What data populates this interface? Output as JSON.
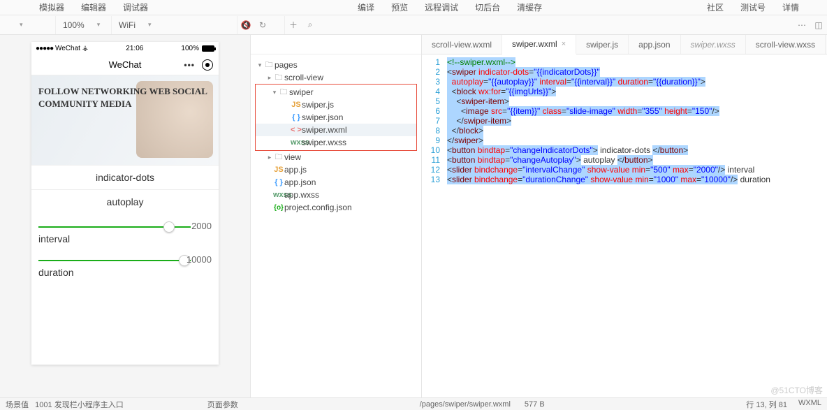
{
  "topbar": {
    "left": [
      "模拟器",
      "编辑器",
      "调试器"
    ],
    "mid": [
      "编译",
      "预览",
      "远程调试",
      "切后台",
      "清缓存"
    ],
    "right": [
      "社区",
      "测试号",
      "详情"
    ]
  },
  "subbar": {
    "dd1": "",
    "dd2": "100%",
    "dd3": "WiFi"
  },
  "phone": {
    "carrier": "WeChat",
    "time": "21:06",
    "battery": "100%",
    "title": "WeChat",
    "sketch": "  FOLLOW   NETWORKING\nWEB  SOCIAL  COMMUNITY\n     MEDIA",
    "btn1": "indicator-dots",
    "btn2": "autoplay",
    "sl1": {
      "value": "2000",
      "label": "interval",
      "pos": "82%"
    },
    "sl2": {
      "value": "10000",
      "label": "duration",
      "pos": "92%"
    }
  },
  "tree": {
    "root": "pages",
    "items": [
      {
        "t": "folder",
        "name": "scroll-view",
        "arrow": "▸",
        "indent": 22
      },
      {
        "t": "group-start"
      },
      {
        "t": "folder",
        "name": "swiper",
        "arrow": "▾",
        "indent": 22,
        "open": true
      },
      {
        "t": "js",
        "name": "swiper.js",
        "indent": 40
      },
      {
        "t": "json",
        "name": "swiper.json",
        "indent": 40
      },
      {
        "t": "wxml",
        "name": "swiper.wxml",
        "indent": 40,
        "sel": true
      },
      {
        "t": "wxss",
        "name": "swiper.wxss",
        "indent": 40
      },
      {
        "t": "group-end"
      },
      {
        "t": "folder",
        "name": "view",
        "arrow": "▸",
        "indent": 22
      },
      {
        "t": "js",
        "name": "app.js",
        "indent": 22
      },
      {
        "t": "json",
        "name": "app.json",
        "indent": 22
      },
      {
        "t": "wxss",
        "name": "app.wxss",
        "indent": 22
      },
      {
        "t": "json",
        "name": "project.config.json",
        "indent": 22,
        "green": true
      }
    ]
  },
  "tabs": [
    {
      "label": "scroll-view.wxml"
    },
    {
      "label": "swiper.wxml",
      "active": true,
      "close": true
    },
    {
      "label": "swiper.js"
    },
    {
      "label": "app.json"
    },
    {
      "label": "swiper.wxss",
      "italic": true
    },
    {
      "label": "scroll-view.wxss"
    }
  ],
  "code": [
    {
      "n": 1,
      "h": "<span class='sel-bg'><span class='cm'>&lt;!--swiper.wxml--&gt;</span></span>"
    },
    {
      "n": 2,
      "h": "<span class='sel-bg'>&lt;<span class='tg'>swiper</span> <span class='at'>indicator-dots</span>=<span class='st'>\"{{indicatorDots}}\"</span></span>"
    },
    {
      "n": 3,
      "h": "<span class='sel-bg'>  <span class='at'>autoplay</span>=<span class='st'>\"{{autoplay}}\"</span> <span class='at'>interval</span>=<span class='st'>\"{{interval}}\"</span> <span class='at'>duration</span>=<span class='st'>\"{{duration}}\"</span>&gt;</span>"
    },
    {
      "n": 4,
      "h": "<span class='sel-bg'>  &lt;<span class='tg'>block</span> <span class='at'>wx:for</span>=<span class='st'>\"{{imgUrls}}\"</span>&gt;</span>"
    },
    {
      "n": 5,
      "h": "<span class='sel-bg'>    &lt;<span class='tg'>swiper-item</span>&gt;</span>"
    },
    {
      "n": 6,
      "h": "<span class='sel-bg'>      &lt;<span class='tg'>image</span> <span class='at'>src</span>=<span class='st'>\"{{item}}\"</span> <span class='at'>class</span>=<span class='st'>\"slide-image\"</span> <span class='at'>width</span>=<span class='st'>\"355\"</span> <span class='at'>height</span>=<span class='st'>\"150\"</span>/&gt;</span>"
    },
    {
      "n": 7,
      "h": "<span class='sel-bg'>    &lt;/<span class='tg'>swiper-item</span>&gt;</span>"
    },
    {
      "n": 8,
      "h": "<span class='sel-bg'>  &lt;/<span class='tg'>block</span>&gt;</span>"
    },
    {
      "n": 9,
      "h": "<span class='sel-bg'>&lt;/<span class='tg'>swiper</span>&gt;</span>"
    },
    {
      "n": 10,
      "h": "<span class='sel-bg'>&lt;<span class='tg'>button</span> <span class='at'>bindtap</span>=<span class='st'>\"changeIndicatorDots\"</span>&gt;</span> indicator-dots <span class='sel-bg'>&lt;/<span class='tg'>button</span>&gt;</span>"
    },
    {
      "n": 11,
      "h": "<span class='sel-bg'>&lt;<span class='tg'>button</span> <span class='at'>bindtap</span>=<span class='st'>\"changeAutoplay\"</span>&gt;</span> autoplay <span class='sel-bg'>&lt;/<span class='tg'>button</span>&gt;</span>"
    },
    {
      "n": 12,
      "h": "<span class='sel-bg'>&lt;<span class='tg'>slider</span> <span class='at'>bindchange</span>=<span class='st'>\"intervalChange\"</span> <span class='at'>show-value</span> <span class='at'>min</span>=<span class='st'>\"500\"</span> <span class='at'>max</span>=<span class='st'>\"2000\"</span>/&gt;</span> interval"
    },
    {
      "n": 13,
      "h": "<span class='sel-bg'>&lt;<span class='tg'>slider</span> <span class='at'>bindchange</span>=<span class='st'>\"durationChange\"</span> <span class='at'>show-value</span> <span class='at'>min</span>=<span class='st'>\"1000\"</span> <span class='at'>max</span>=<span class='st'>\"10000\"</span>/&gt;</span> duration"
    }
  ],
  "footer": {
    "left1": "场景值",
    "left2": "1001 发现栏小程序主入口",
    "left3": "页面参数",
    "path": "/pages/swiper/swiper.wxml",
    "size": "577 B",
    "pos": "行 13, 列 81",
    "lang": "WXML"
  },
  "watermark": "@51CTO博客"
}
